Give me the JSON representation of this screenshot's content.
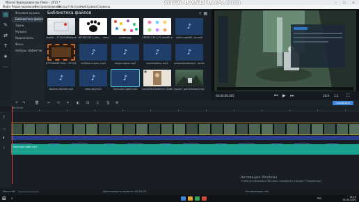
{
  "window": {
    "title": "Movavi Видеоредактор Плюс – 2021 *",
    "watermark": "www.BANDICAM.com"
  },
  "menu": [
    {
      "label": "Файл"
    },
    {
      "label": "Редактирование"
    },
    {
      "label": "Воспроизведение"
    },
    {
      "label": "Экспорт"
    },
    {
      "label": "Настройки"
    },
    {
      "label": "Справка"
    },
    {
      "label": "Сервисы"
    }
  ],
  "categories": [
    {
      "label": "Фоновая музыка"
    },
    {
      "label": "Библиотека файлов"
    },
    {
      "label": "Звуки"
    },
    {
      "label": "Музыка"
    },
    {
      "label": "Видеоклипы"
    },
    {
      "label": "Фоны"
    },
    {
      "label": "Наборы эффектов"
    }
  ],
  "library": {
    "title": "Библиотека файлов",
    "items": [
      {
        "caption": "сaulse... 1724-4 обложка",
        "kind": "photo"
      },
      {
        "caption": "1674621341_cats-... лапа-лапа.jpg",
        "kind": "paw"
      },
      {
        "caption": "ранил.jpg",
        "kind": "pattern"
      },
      {
        "caption": "1366512341_45-drawfir-with-51.jpg",
        "kind": "dots"
      },
      {
        "caption": "arbor-cowhall...ra.mp3",
        "kind": "audio"
      },
      {
        "caption": "87702b0457a5a... 2710030.png",
        "kind": "film"
      },
      {
        "caption": "zcl00ud.crayon..mp3",
        "kind": "audio"
      },
      {
        "caption": "sergro-egner.mp3",
        "kind": "audio"
      },
      {
        "caption": "anyelnabeisc.mp3",
        "kind": "audio"
      },
      {
        "caption": "zeaimebaizebelycl ..ionstrip.mp3",
        "kind": "audio"
      },
      {
        "caption": "бизнес-Rachet.mp3",
        "kind": "audio"
      },
      {
        "caption": "elect-sky.mp3",
        "kind": "audio"
      },
      {
        "caption": "kevin-ban-light.mp3",
        "kind": "audio",
        "selected": true
      },
      {
        "caption": "Converted-bedtime (2080.mp4",
        "kind": "portrait"
      },
      {
        "caption": "проект для блогов 6.mp4",
        "kind": "landscape"
      }
    ]
  },
  "preview": {
    "time": "00:00:00.000",
    "ratio": "16:9",
    "scale": "1:1"
  },
  "toolbar": {
    "export_label": "Сохранить"
  },
  "timeline": {
    "ruler_start": "00:00:00",
    "music_clip": "kevin-ban-light.mp3",
    "scale_label": "Масштаб:",
    "duration_label": "Длительность проекта: 00:00:59",
    "optimization_label": "Оптимизация: нет"
  },
  "activation": {
    "heading": "Активация Windows",
    "text": "Чтобы активировать Windows, перейдите в раздел \"Параметры\"."
  },
  "taskbar": {
    "time": "14:15",
    "date": "01.04.2021",
    "lang": "РУС"
  },
  "colors": {
    "accent": "#3fd0d6",
    "export": "#3d86d9",
    "music_track": "#19a08f",
    "video_border": "#b99b3a",
    "playhead": "#e2483a"
  }
}
